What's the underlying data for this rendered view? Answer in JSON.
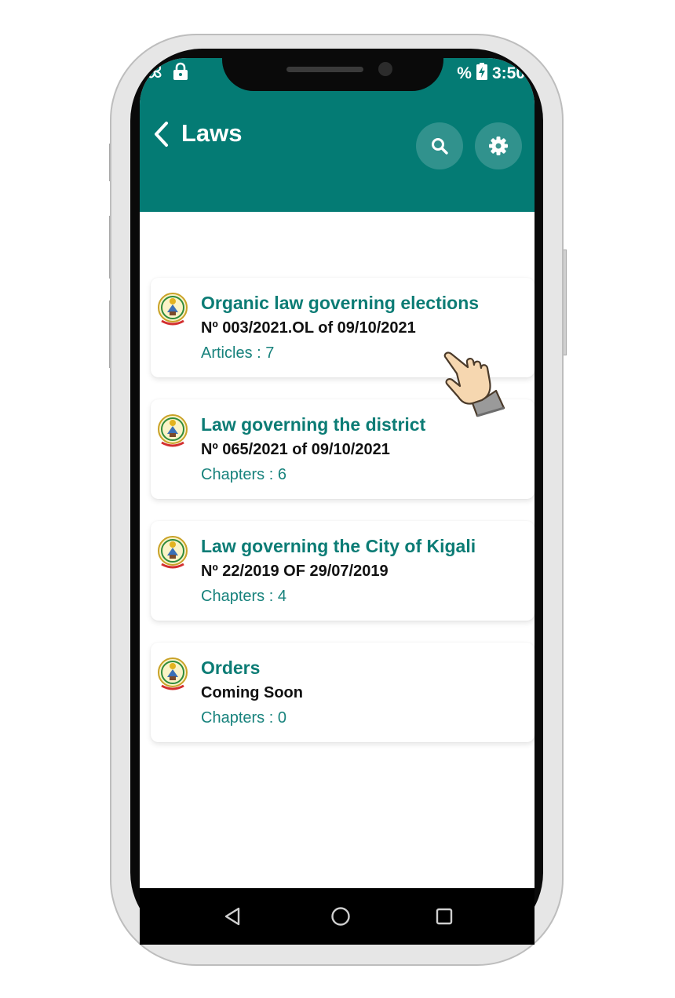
{
  "status_bar": {
    "battery": "%",
    "time": "3:50"
  },
  "appbar": {
    "title": "Laws",
    "accent_color": "#047b74",
    "icons": [
      "chevron-left-icon",
      "search-icon",
      "gear-icon"
    ]
  },
  "laws": [
    {
      "title": "Organic law governing elections",
      "number": "Nº 003/2021.OL of 09/10/2021",
      "meta": "Articles : 7"
    },
    {
      "title": "Law governing the district",
      "number": "Nº 065/2021 of 09/10/2021",
      "meta": "Chapters : 6"
    },
    {
      "title": "Law governing the City of Kigali",
      "number": "Nº 22/2019 OF 29/07/2019",
      "meta": "Chapters : 4"
    },
    {
      "title": "Orders",
      "number": "Coming Soon",
      "meta": "Chapters : 0"
    }
  ],
  "nav_bar": {
    "icons": [
      "nav-back-icon",
      "nav-home-icon",
      "nav-recents-icon"
    ]
  }
}
